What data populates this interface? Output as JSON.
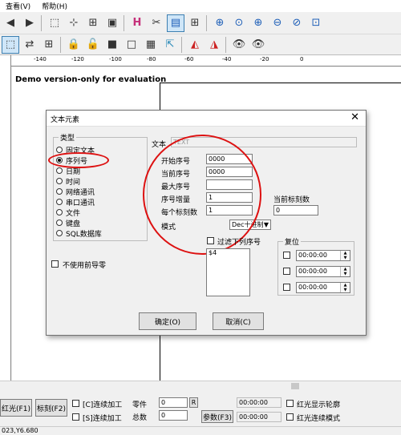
{
  "menubar": {
    "items": [
      "查看(V)",
      "帮助(H)"
    ]
  },
  "toolbar1": {
    "icons": [
      "back-icon",
      "forward-icon",
      "select-icon",
      "node-icon",
      "group-icon",
      "align-icon",
      "text-h-icon",
      "tools-icon",
      "table-icon",
      "grid-icon",
      "zoom-in-icon",
      "zoom-fit-icon",
      "zoom-in-2-icon",
      "zoom-out-icon",
      "zoom-select-icon",
      "zoom-page-icon"
    ]
  },
  "canvas": {
    "demo_text": "Demo version-only for evaluation"
  },
  "ruler": {
    "labels": [
      "-140",
      "-120",
      "-100",
      "-80",
      "-60",
      "-40",
      "-20",
      "0"
    ]
  },
  "dialog": {
    "title": "文本元素",
    "type_group_title": "类型",
    "types": [
      "固定文本",
      "序列号",
      "日期",
      "时间",
      "网络通讯",
      "串口通讯",
      "文件",
      "键盘",
      "SQL数据库"
    ],
    "selected_type_index": 1,
    "text_label": "文本",
    "text_value": "TEXT",
    "start_label": "开始序号",
    "start_value": "0000",
    "current_label": "当前序号",
    "current_value": "0000",
    "max_label": "最大序号",
    "max_value": "",
    "increment_label": "序号增量",
    "increment_value": "1",
    "per_mark_label": "每个标刻数",
    "per_mark_value": "1",
    "current_mark_label": "当前标刻数",
    "current_mark_value": "0",
    "mode_label": "模式",
    "mode_value": "Dec十进制",
    "filter_label": "过滤下列序号",
    "filter_value": "$4",
    "reset_group_title": "复位",
    "reset_times": [
      "00:00:00",
      "00:00:00",
      "00:00:00"
    ],
    "no_leading_zero_label": "不使用前导零",
    "ok_label": "确定(O)",
    "cancel_label": "取消(C)"
  },
  "bottom": {
    "red_light_label": "红光(F1)",
    "mark_label": "标刻(F2)",
    "continuous_label": "[C]连续加工",
    "s_continuous_label": "[S]连续加工",
    "parts_label": "零件",
    "parts_value": "0",
    "r_label": "R",
    "total_label": "总数",
    "total_value": "0",
    "time1_value": "00:00:00",
    "time2_value": "00:00:00",
    "param_label": "参数(F3)",
    "show_contour_label": "红光显示轮廓",
    "continuous_mode_label": "红光连续模式"
  },
  "status": {
    "text": "023,Y6.680"
  },
  "colors": {
    "annotation": "#dd1111",
    "selected_tool": "#cfe6f8"
  }
}
